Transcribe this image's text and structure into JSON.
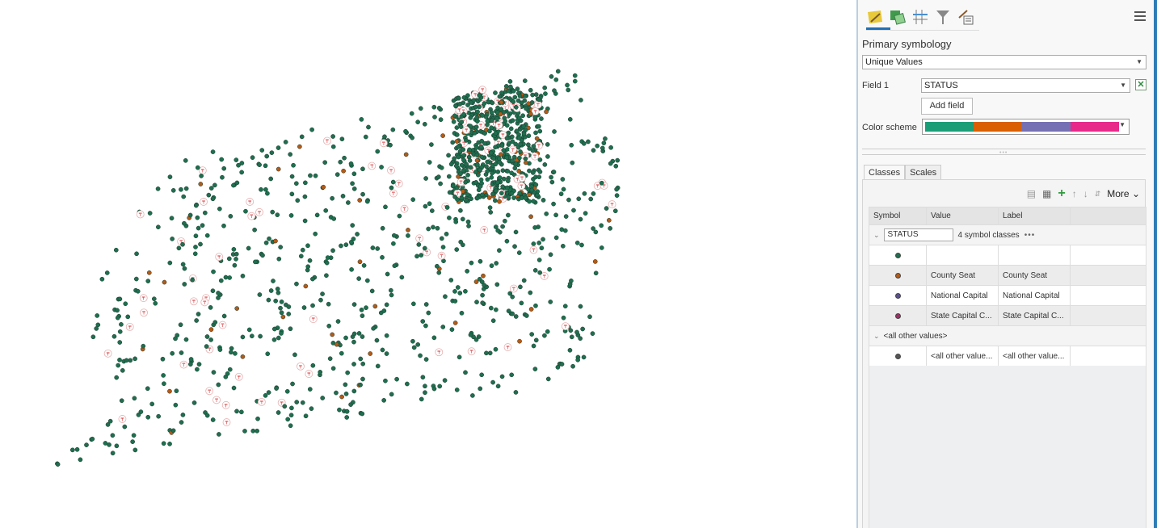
{
  "map": {
    "legend_colors": {
      "default": "#1f6e4f",
      "county_seat": "#b45a17",
      "state_capital_symbol": "#d9373a"
    }
  },
  "panel": {
    "tabs": [
      {
        "name": "primary-symbology-tab",
        "icon": "paintbrush-icon",
        "active": true
      },
      {
        "name": "vary-symbology-tab",
        "icon": "vary-symbology-icon"
      },
      {
        "name": "symbol-layer-drawing-tab",
        "icon": "drawing-order-icon"
      },
      {
        "name": "filter-tab",
        "icon": "funnel-icon"
      },
      {
        "name": "label-tab",
        "icon": "label-pen-icon"
      }
    ],
    "section_title": "Primary symbology",
    "renderer": "Unique Values",
    "field1_label": "Field 1",
    "field1_value": "STATUS",
    "add_field_label": "Add field",
    "color_scheme_label": "Color scheme",
    "color_scheme": [
      "#1b9e77",
      "#d95f02",
      "#7570b3",
      "#e7298a"
    ],
    "subtabs": [
      "Classes",
      "Scales"
    ],
    "more_label": "More",
    "columns": [
      "Symbol",
      "Value",
      "Label",
      ""
    ],
    "group": {
      "field": "STATUS",
      "count_text": "4 symbol classes",
      "dots": "•••"
    },
    "rows": [
      {
        "color": "#1f6e4f",
        "value": "",
        "label": ""
      },
      {
        "color": "#b45a17",
        "value": "County Seat",
        "label": "County Seat"
      },
      {
        "color": "#5a4f8f",
        "value": "National Capital",
        "label": "National Capital"
      },
      {
        "color": "#9c2f66",
        "value": "State Capital  C...",
        "label": "State Capital  C..."
      }
    ],
    "other_group_label": "<all other values>",
    "other_row": {
      "color": "#555555",
      "value": "<all other value...",
      "label": "<all other value..."
    }
  }
}
